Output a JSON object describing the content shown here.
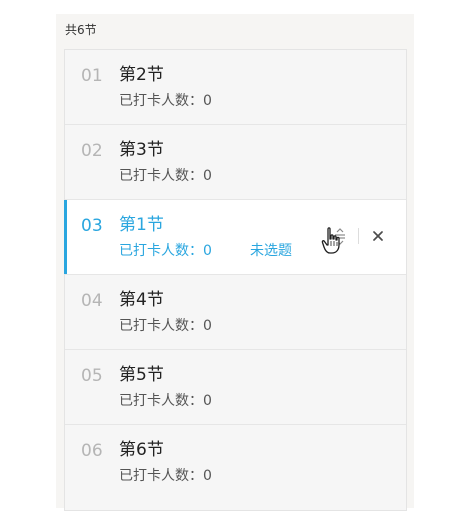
{
  "header": {
    "count_text": "共6节"
  },
  "sections": [
    {
      "number": "01",
      "title": "第2节",
      "checkin": "已打卡人数：0"
    },
    {
      "number": "02",
      "title": "第3节",
      "checkin": "已打卡人数：0"
    },
    {
      "number": "03",
      "title": "第1节",
      "checkin": "已打卡人数：0",
      "status": "未选题",
      "active": true
    },
    {
      "number": "04",
      "title": "第4节",
      "checkin": "已打卡人数：0"
    },
    {
      "number": "05",
      "title": "第5节",
      "checkin": "已打卡人数：0"
    },
    {
      "number": "06",
      "title": "第6节",
      "checkin": "已打卡人数：0"
    }
  ],
  "icons": {
    "sort": "sort-icon",
    "close": "close-icon",
    "cursor": "hand-pointer-icon"
  },
  "colors": {
    "accent": "#2aa6df",
    "panel_bg": "#f6f5f3",
    "active_bg": "#ffffff"
  }
}
